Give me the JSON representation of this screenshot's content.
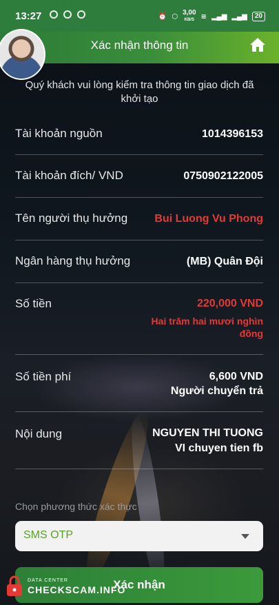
{
  "status_bar": {
    "time": "13:27",
    "net_speed": "3,00",
    "net_unit": "KB/S",
    "battery": "20"
  },
  "header": {
    "title": "Xác nhận thông tin"
  },
  "notice": "Quý khách vui lòng kiểm tra thông tin giao dịch đã khởi tạo",
  "details": [
    {
      "label": "Tài khoản nguồn",
      "value": "1014396153"
    },
    {
      "label": "Tài khoản đích/ VND",
      "value": "0750902122005"
    },
    {
      "label": "Tên người thụ hưởng",
      "value": "Bui Luong Vu Phong"
    },
    {
      "label": "Ngân hàng thụ hưởng",
      "value": "(MB) Quân Đội"
    },
    {
      "label": "Số tiền",
      "value": "220,000 VND",
      "sub": "Hai trăm hai mươi nghìn đồng"
    },
    {
      "label": "Số tiền phí",
      "value": "6,600 VND",
      "sub": "Người chuyển trả"
    },
    {
      "label": "Nội dung",
      "value": "NGUYEN THI TUONG",
      "sub": "VI chuyen tien fb"
    }
  ],
  "auth": {
    "label": "Chọn phương thức xác thực",
    "selected": "SMS OTP"
  },
  "confirm_button": "Xác nhận",
  "watermark": {
    "line1": "DATA CENTER",
    "line2": "CHECKSCAM.INFO"
  },
  "colors": {
    "header_start": "#2c7b38",
    "header_end": "#6bb22b",
    "red_value": "#e53935",
    "select_text": "#5aa02c"
  }
}
